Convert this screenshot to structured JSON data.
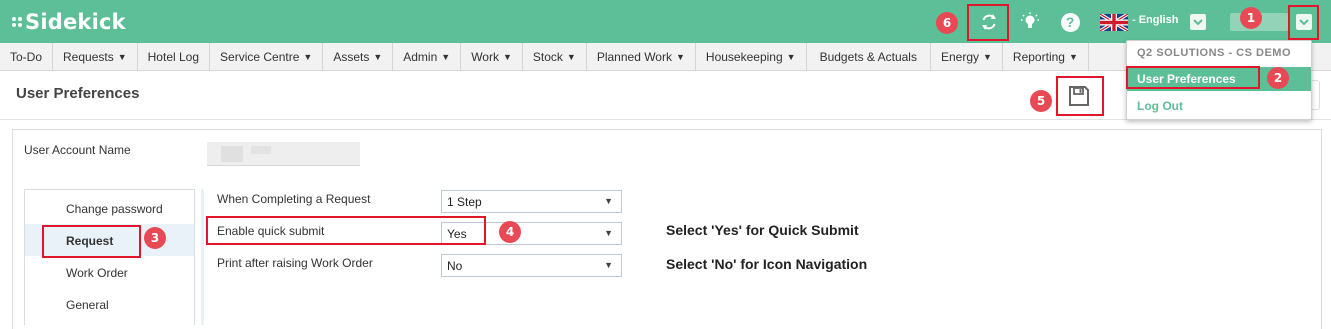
{
  "app": {
    "name": "Sidekick"
  },
  "header": {
    "language": "- English",
    "icons": [
      "refresh-icon",
      "lightbulb-icon",
      "help-icon",
      "uk-flag-icon",
      "chevron-down-icon",
      "user-menu-toggle"
    ],
    "help_glyph": "?"
  },
  "nav": [
    {
      "label": "To-Do",
      "arrow": ""
    },
    {
      "label": "Requests",
      "arrow": "▼"
    },
    {
      "label": "Hotel Log",
      "arrow": ""
    },
    {
      "label": "Service Centre",
      "arrow": "▼"
    },
    {
      "label": "Assets",
      "arrow": "▼"
    },
    {
      "label": "Admin",
      "arrow": "▼"
    },
    {
      "label": "Work",
      "arrow": "▼"
    },
    {
      "label": "Stock",
      "arrow": "▼"
    },
    {
      "label": "Planned Work",
      "arrow": "▼"
    },
    {
      "label": "Housekeeping",
      "arrow": "▼"
    },
    {
      "label": "Budgets & Actuals",
      "arrow": ""
    },
    {
      "label": "Energy",
      "arrow": "▼"
    },
    {
      "label": "Reporting",
      "arrow": "▼"
    }
  ],
  "dropdown": {
    "header": "Q2 SOLUTIONS - CS DEMO",
    "items": [
      "User Preferences",
      "Log Out"
    ]
  },
  "page": {
    "title": "User Preferences"
  },
  "account": {
    "label": "User Account Name"
  },
  "sidemenu": [
    "Change password",
    "Request",
    "Work Order",
    "General"
  ],
  "form": {
    "rows": [
      {
        "label": "When Completing a Request",
        "value": "1 Step"
      },
      {
        "label": "Enable quick submit",
        "value": "Yes"
      },
      {
        "label": "Print after raising Work Order",
        "value": "No"
      }
    ],
    "arrow": "▼"
  },
  "hints": [
    "Select 'Yes' for Quick Submit",
    "Select 'No' for Icon Navigation"
  ],
  "badges": [
    "1",
    "2",
    "3",
    "4",
    "5",
    "6"
  ],
  "colors": {
    "brand": "#5cbf97",
    "annotation": "#e0172b",
    "badge": "#e84a55"
  }
}
